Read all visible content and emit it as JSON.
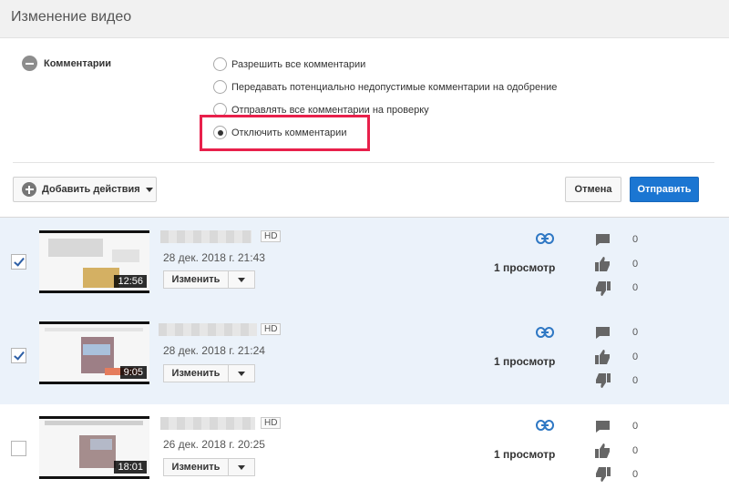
{
  "header": {
    "title": "Изменение видео"
  },
  "comments_section": {
    "label": "Комментарии",
    "options": [
      {
        "label": "Разрешить все комментарии",
        "checked": false
      },
      {
        "label": "Передавать потенциально недопустимые комментарии на одобрение",
        "checked": false
      },
      {
        "label": "Отправлять все комментарии на проверку",
        "checked": false
      },
      {
        "label": "Отключить комментарии",
        "checked": true
      }
    ]
  },
  "actions": {
    "add_label": "Добавить действия",
    "cancel_label": "Отмена",
    "submit_label": "Отправить"
  },
  "colors": {
    "accent": "#1b76d2",
    "highlight": "#e8204b",
    "selected_row": "#ebf2fa"
  },
  "videos": [
    {
      "selected": true,
      "duration": "12:56",
      "badge": "HD",
      "date": "28 дек. 2018 г. 21:43",
      "edit_label": "Изменить",
      "views": "1 просмотр",
      "comments": "0",
      "likes": "0",
      "dislikes": "0"
    },
    {
      "selected": true,
      "duration": "9:05",
      "badge": "HD",
      "date": "28 дек. 2018 г. 21:24",
      "edit_label": "Изменить",
      "views": "1 просмотр",
      "comments": "0",
      "likes": "0",
      "dislikes": "0"
    },
    {
      "selected": false,
      "duration": "18:01",
      "badge": "HD",
      "date": "26 дек. 2018 г. 20:25",
      "edit_label": "Изменить",
      "views": "1 просмотр",
      "comments": "0",
      "likes": "0",
      "dislikes": "0"
    }
  ]
}
